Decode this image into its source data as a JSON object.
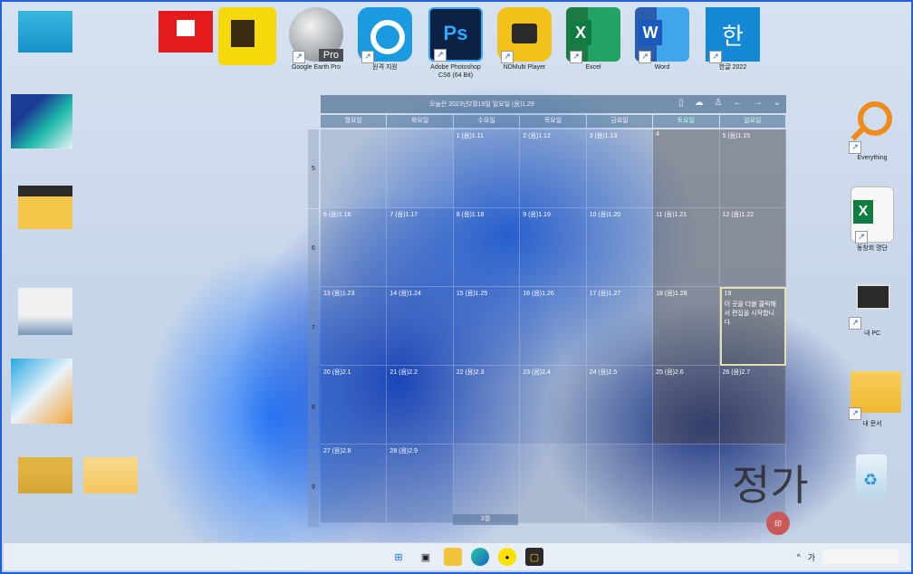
{
  "desktop": {
    "top_icons": [
      {
        "label": "",
        "color": "#e31b1b"
      },
      {
        "label": "",
        "color": "#f5d90a"
      },
      {
        "label": "Google Earth Pro",
        "color": "#7a7f86"
      },
      {
        "label": "원격 지원",
        "color": "#1a9be0"
      },
      {
        "label": "Adobe Photoshop CS6 (64 Bit)",
        "color": "#0b2244"
      },
      {
        "label": "NDMulti Player",
        "color": "#f2c21b"
      },
      {
        "label": "Excel",
        "color": "#1d7a44"
      },
      {
        "label": "Word",
        "color": "#2b5cae"
      },
      {
        "label": "한글 2022",
        "color": "#1487d5"
      }
    ],
    "right_icons": [
      {
        "label": "Everything",
        "color": "#f08a1a"
      },
      {
        "label": "동창회 명단",
        "color": "#1d7a44"
      },
      {
        "label": "내 PC",
        "color": "#333333"
      },
      {
        "label": "내 문서",
        "color": "#f3c33b"
      },
      {
        "label": "휴지통",
        "color": "#3aa2d9"
      }
    ],
    "pro_badge": "Pro",
    "ps_badge": "Ps",
    "excel_badge": "X",
    "word_badge": "W",
    "hwp_badge": "한"
  },
  "calendar": {
    "header_title": "오늘은 2023년2월19일 일요일 (음)1.29",
    "tool_icons": [
      "phone-icon",
      "cloud-icon",
      "user-icon",
      "arrow-left-icon",
      "arrow-right-icon",
      "chevron-down-icon"
    ],
    "day_names": [
      "월요일",
      "화요일",
      "수요일",
      "목요일",
      "금요일",
      "토요일",
      "일요일"
    ],
    "week_numbers": [
      "5",
      "6",
      "7",
      "8",
      "9"
    ],
    "weeks": [
      [
        "",
        "",
        "1 (음)1.11",
        "2 (음)1.12",
        "3 (음)1.13",
        "4",
        "5 (음)1.15"
      ],
      [
        "6 (음)1.16",
        "7 (음)1.17",
        "8 (음)1.18",
        "9 (음)1.19",
        "10 (음)1.20",
        "11 (음)1.21",
        "12 (음)1.22"
      ],
      [
        "13 (음)1.23",
        "14 (음)1.24",
        "15 (음)1.25",
        "16 (음)1.26",
        "17 (음)1.27",
        "18 (음)1.28",
        "19"
      ],
      [
        "20 (음)2.1",
        "21 (음)2.2",
        "22 (음)2.3",
        "23 (음)2.4",
        "24 (음)2.5",
        "25 (음)2.6",
        "26 (음)2.7"
      ],
      [
        "27 (음)2.8",
        "28 (음)2.9",
        "",
        "",
        "",
        "",
        ""
      ]
    ],
    "today_note": "이 곳을 더블 클릭해서 편집을 시작합니다.",
    "footer_month": "3월"
  },
  "taskbar": {
    "apps": [
      "start-icon",
      "task-view-icon",
      "file-explorer-icon",
      "edge-icon",
      "kakaotalk-icon",
      "app-icon"
    ],
    "tray_chevron": "^",
    "ime": "가"
  }
}
